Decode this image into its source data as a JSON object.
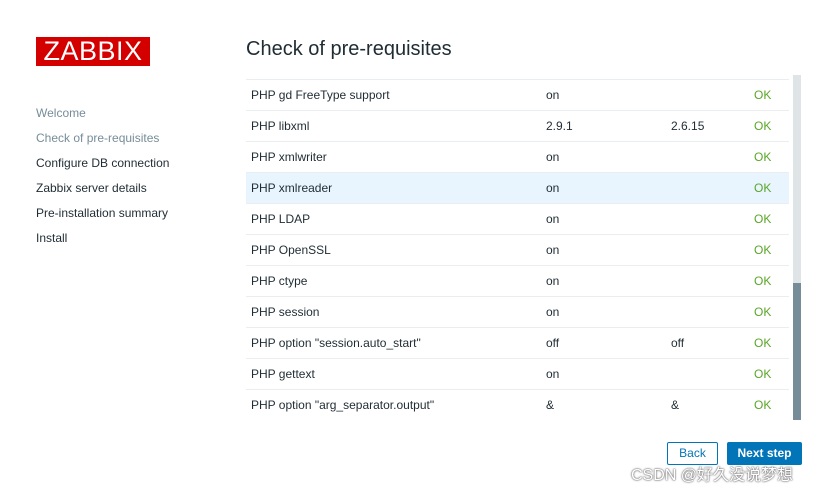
{
  "logo": {
    "text": "ZABBIX",
    "color": "#d40000"
  },
  "nav": {
    "items": [
      {
        "label": "Welcome",
        "state": "done"
      },
      {
        "label": "Check of pre-requisites",
        "state": "done"
      },
      {
        "label": "Configure DB connection",
        "state": "pending"
      },
      {
        "label": "Zabbix server details",
        "state": "pending"
      },
      {
        "label": "Pre-installation summary",
        "state": "pending"
      },
      {
        "label": "Install",
        "state": "pending"
      }
    ]
  },
  "page": {
    "title": "Check of pre-requisites"
  },
  "requirements": {
    "rows": [
      {
        "name": "PHP gd FreeType support",
        "current": "on",
        "required": "",
        "result": "OK"
      },
      {
        "name": "PHP libxml",
        "current": "2.9.1",
        "required": "2.6.15",
        "result": "OK"
      },
      {
        "name": "PHP xmlwriter",
        "current": "on",
        "required": "",
        "result": "OK"
      },
      {
        "name": "PHP xmlreader",
        "current": "on",
        "required": "",
        "result": "OK",
        "highlighted": true
      },
      {
        "name": "PHP LDAP",
        "current": "on",
        "required": "",
        "result": "OK"
      },
      {
        "name": "PHP OpenSSL",
        "current": "on",
        "required": "",
        "result": "OK"
      },
      {
        "name": "PHP ctype",
        "current": "on",
        "required": "",
        "result": "OK"
      },
      {
        "name": "PHP session",
        "current": "on",
        "required": "",
        "result": "OK"
      },
      {
        "name": "PHP option \"session.auto_start\"",
        "current": "off",
        "required": "off",
        "result": "OK"
      },
      {
        "name": "PHP gettext",
        "current": "on",
        "required": "",
        "result": "OK"
      },
      {
        "name": "PHP option \"arg_separator.output\"",
        "current": "&",
        "required": "&",
        "result": "OK"
      }
    ]
  },
  "buttons": {
    "back": "Back",
    "next": "Next step"
  },
  "watermark": "CSDN @好久没说梦想",
  "colors": {
    "ok": "#59a627",
    "primary": "#0275b8",
    "highlight_row": "#e8f5ff"
  }
}
